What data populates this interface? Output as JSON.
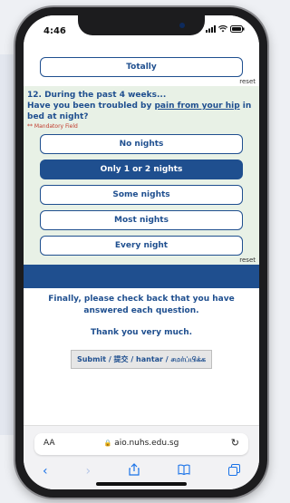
{
  "status": {
    "time": "4:46"
  },
  "prev_question": {
    "option": "Totally",
    "reset": "reset"
  },
  "question": {
    "number_intro": "12. During the past 4 weeks...",
    "text_before": "Have you been troubled by ",
    "text_link": "pain from your hip",
    "text_after": " in bed at night?",
    "mandatory": "** Mandatory Field",
    "options": [
      "No nights",
      "Only 1 or 2 nights",
      "Some nights",
      "Most nights",
      "Every night"
    ],
    "selected": "Only 1 or 2 nights",
    "reset": "reset"
  },
  "final": {
    "check": "Finally, please check back that you have answered each question.",
    "thanks": "Thank you very much.",
    "submit": "Submit / 提交 / hantar / சமர்ப்பிக்க"
  },
  "browser": {
    "aa": "AA",
    "url": "aio.nuhs.edu.sg",
    "lock": "🔒"
  },
  "colors": {
    "accent": "#1f4f8f",
    "panel": "#e8f1e6"
  }
}
